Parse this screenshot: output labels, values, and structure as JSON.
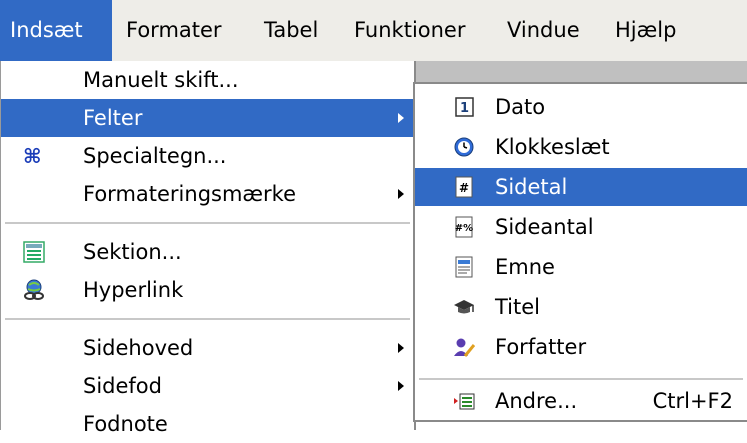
{
  "menubar": {
    "items": [
      {
        "label": "Indsæt"
      },
      {
        "label": "Formater"
      },
      {
        "label": "Tabel"
      },
      {
        "label": "Funktioner"
      },
      {
        "label": "Vindue"
      },
      {
        "label": "Hjælp"
      }
    ]
  },
  "insert_menu": {
    "items": [
      {
        "label": "Manuelt skift..."
      },
      {
        "label": "Felter"
      },
      {
        "label": "Specialtegn..."
      },
      {
        "label": "Formateringsmærke"
      },
      {
        "label": "Sektion..."
      },
      {
        "label": "Hyperlink"
      },
      {
        "label": "Sidehoved"
      },
      {
        "label": "Sidefod"
      },
      {
        "label": "Fodnote"
      }
    ]
  },
  "fields_submenu": {
    "items": [
      {
        "label": "Dato"
      },
      {
        "label": "Klokkeslæt"
      },
      {
        "label": "Sidetal"
      },
      {
        "label": "Sideantal"
      },
      {
        "label": "Emne"
      },
      {
        "label": "Titel"
      },
      {
        "label": "Forfatter"
      },
      {
        "label": "Andre...",
        "shortcut": "Ctrl+F2"
      }
    ]
  },
  "colors": {
    "highlight": "#316ac5",
    "menubar_bg": "#eeede8"
  }
}
